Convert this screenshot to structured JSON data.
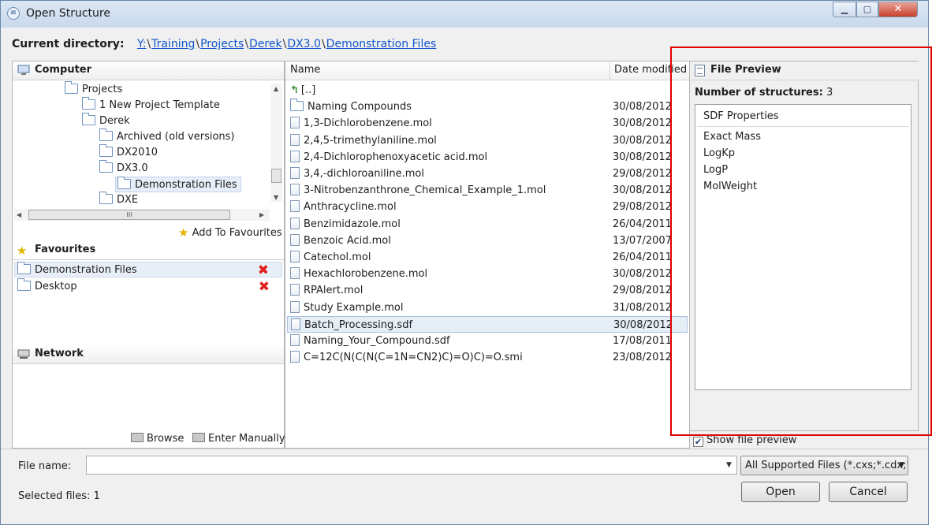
{
  "window": {
    "title": "Open Structure"
  },
  "current_directory": {
    "label": "Current directory:",
    "path": [
      "Y:",
      "Training",
      "Projects",
      "Derek",
      "DX3.0",
      "Demonstration Files"
    ]
  },
  "computer": {
    "heading": "Computer",
    "tree": [
      {
        "label": "Projects"
      },
      {
        "label": "1 New Project Template"
      },
      {
        "label": "Derek"
      },
      {
        "label": "Archived (old versions)"
      },
      {
        "label": "DX2010"
      },
      {
        "label": "DX3.0"
      },
      {
        "label": "Demonstration Files"
      },
      {
        "label": "DXE"
      }
    ],
    "scroll_hint": "III",
    "add_favourites": "Add To Favourites"
  },
  "favourites": {
    "heading": "Favourites",
    "items": [
      {
        "label": "Demonstration Files"
      },
      {
        "label": "Desktop"
      }
    ]
  },
  "network": {
    "heading": "Network",
    "browse": "Browse",
    "enter_manually": "Enter Manually"
  },
  "files": {
    "columns": {
      "name": "Name",
      "date": "Date modified"
    },
    "rows": [
      {
        "name": "[..]",
        "date": ""
      },
      {
        "name": "Naming Compounds",
        "date": "30/08/2012"
      },
      {
        "name": "1,3-Dichlorobenzene.mol",
        "date": "30/08/2012"
      },
      {
        "name": "2,4,5-trimethylaniline.mol",
        "date": "30/08/2012"
      },
      {
        "name": "2,4-Dichlorophenoxyacetic acid.mol",
        "date": "30/08/2012"
      },
      {
        "name": "3,4,-dichloroaniline.mol",
        "date": "29/08/2012"
      },
      {
        "name": "3-Nitrobenzanthrone_Chemical_Example_1.mol",
        "date": "30/08/2012"
      },
      {
        "name": "Anthracycline.mol",
        "date": "29/08/2012"
      },
      {
        "name": "Benzimidazole.mol",
        "date": "26/04/2011"
      },
      {
        "name": "Benzoic Acid.mol",
        "date": "13/07/2007"
      },
      {
        "name": "Catechol.mol",
        "date": "26/04/2011"
      },
      {
        "name": "Hexachlorobenzene.mol",
        "date": "30/08/2012"
      },
      {
        "name": "RPAlert.mol",
        "date": "29/08/2012"
      },
      {
        "name": "Study Example.mol",
        "date": "31/08/2012"
      },
      {
        "name": "Batch_Processing.sdf",
        "date": "30/08/2012"
      },
      {
        "name": "Naming_Your_Compound.sdf",
        "date": "17/08/2011"
      },
      {
        "name": "C=12C(N(C(N(C=1N=CN2)C)=O)C)=O.smi",
        "date": "23/08/2012"
      }
    ]
  },
  "preview": {
    "heading": "File Preview",
    "num_structures_label": "Number of structures:",
    "num_structures_value": "3",
    "props_title": "SDF Properties",
    "props": [
      "Exact Mass",
      "LogKp",
      "LogP",
      "MolWeight"
    ],
    "show_preview": "Show file preview"
  },
  "bottom": {
    "file_name_label": "File name:",
    "file_name_value": "",
    "filter": "All Supported Files (*.cxs;*.cdx;*",
    "selected_files": "Selected files: 1",
    "open": "Open",
    "cancel": "Cancel"
  }
}
